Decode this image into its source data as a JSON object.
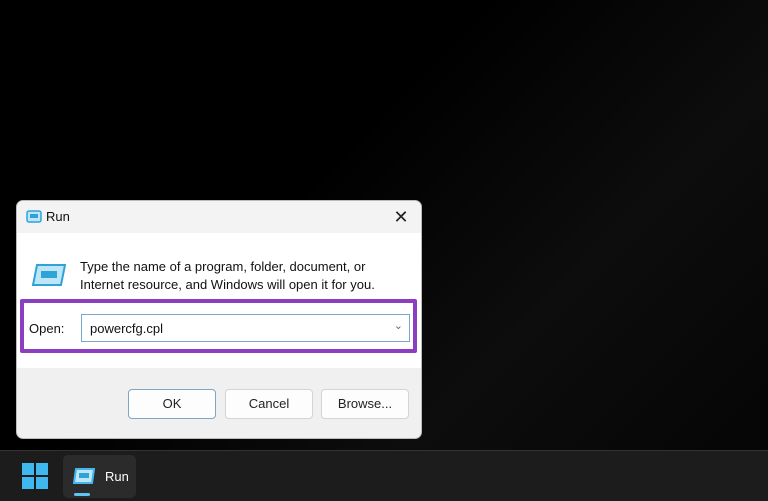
{
  "dialog": {
    "title": "Run",
    "close": "✕",
    "description": "Type the name of a program, folder, document, or Internet resource, and Windows will open it for you.",
    "open_label": "Open:",
    "open_value": "powercfg.cpl",
    "ok": "OK",
    "cancel": "Cancel",
    "browse": "Browse..."
  },
  "taskbar": {
    "run_label": "Run"
  },
  "colors": {
    "highlight": "#8b3fc0",
    "accent": "#3fb8f0"
  }
}
